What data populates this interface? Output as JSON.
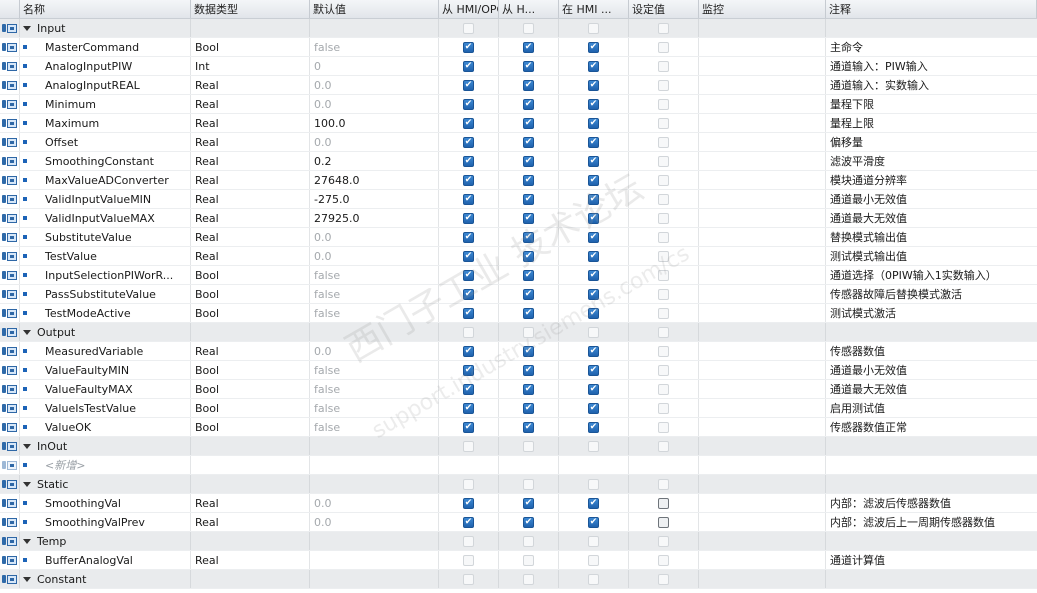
{
  "headers": {
    "name": "名称",
    "type": "数据类型",
    "default": "默认值",
    "hmi_opc": "从 HMI/OPC...",
    "hmi_h": "从 H...",
    "hmi_in": "在 HMI ...",
    "setpoint": "设定值",
    "monitor": "监控",
    "comment": "注释"
  },
  "rows": [
    {
      "kind": "section",
      "name": "Input",
      "icon": "interface-icon"
    },
    {
      "kind": "var",
      "name": "MasterCommand",
      "type": "Bool",
      "default": "false",
      "default_muted": true,
      "hmi": [
        true,
        true,
        true
      ],
      "set": "off",
      "comment": "主命令"
    },
    {
      "kind": "var",
      "name": "AnalogInputPIW",
      "type": "Int",
      "default": "0",
      "default_muted": true,
      "hmi": [
        true,
        true,
        true
      ],
      "set": "off",
      "comment": "通道输入：PIW输入"
    },
    {
      "kind": "var",
      "name": "AnalogInputREAL",
      "type": "Real",
      "default": "0.0",
      "default_muted": true,
      "hmi": [
        true,
        true,
        true
      ],
      "set": "off",
      "comment": "通道输入：实数输入"
    },
    {
      "kind": "var",
      "name": "Minimum",
      "type": "Real",
      "default": "0.0",
      "default_muted": true,
      "hmi": [
        true,
        true,
        true
      ],
      "set": "off",
      "comment": "量程下限"
    },
    {
      "kind": "var",
      "name": "Maximum",
      "type": "Real",
      "default": "100.0",
      "default_muted": false,
      "hmi": [
        true,
        true,
        true
      ],
      "set": "off",
      "comment": "量程上限"
    },
    {
      "kind": "var",
      "name": "Offset",
      "type": "Real",
      "default": "0.0",
      "default_muted": true,
      "hmi": [
        true,
        true,
        true
      ],
      "set": "off",
      "comment": "偏移量"
    },
    {
      "kind": "var",
      "name": "SmoothingConstant",
      "type": "Real",
      "default": "0.2",
      "default_muted": false,
      "hmi": [
        true,
        true,
        true
      ],
      "set": "off",
      "comment": "滤波平滑度"
    },
    {
      "kind": "var",
      "name": "MaxValueADConverter",
      "type": "Real",
      "default": "27648.0",
      "default_muted": false,
      "hmi": [
        true,
        true,
        true
      ],
      "set": "off",
      "comment": "模块通道分辨率"
    },
    {
      "kind": "var",
      "name": "ValidInputValueMIN",
      "type": "Real",
      "default": "-275.0",
      "default_muted": false,
      "hmi": [
        true,
        true,
        true
      ],
      "set": "off",
      "comment": "通道最小无效值"
    },
    {
      "kind": "var",
      "name": "ValidInputValueMAX",
      "type": "Real",
      "default": "27925.0",
      "default_muted": false,
      "hmi": [
        true,
        true,
        true
      ],
      "set": "off",
      "comment": "通道最大无效值"
    },
    {
      "kind": "var",
      "name": "SubstituteValue",
      "type": "Real",
      "default": "0.0",
      "default_muted": true,
      "hmi": [
        true,
        true,
        true
      ],
      "set": "off",
      "comment": "替换模式输出值"
    },
    {
      "kind": "var",
      "name": "TestValue",
      "type": "Real",
      "default": "0.0",
      "default_muted": true,
      "hmi": [
        true,
        true,
        true
      ],
      "set": "off",
      "comment": "测试模式输出值"
    },
    {
      "kind": "var",
      "name": "InputSelectionPIWorR...",
      "type": "Bool",
      "default": "false",
      "default_muted": true,
      "hmi": [
        true,
        true,
        true
      ],
      "set": "off",
      "comment": "通道选择（0PIW输入1实数输入）"
    },
    {
      "kind": "var",
      "name": "PassSubstituteValue",
      "type": "Bool",
      "default": "false",
      "default_muted": true,
      "hmi": [
        true,
        true,
        true
      ],
      "set": "off",
      "comment": "传感器故障后替换模式激活"
    },
    {
      "kind": "var",
      "name": "TestModeActive",
      "type": "Bool",
      "default": "false",
      "default_muted": true,
      "hmi": [
        true,
        true,
        true
      ],
      "set": "off",
      "comment": "测试模式激活"
    },
    {
      "kind": "section",
      "name": "Output",
      "icon": "interface-icon"
    },
    {
      "kind": "var",
      "name": "MeasuredVariable",
      "type": "Real",
      "default": "0.0",
      "default_muted": true,
      "hmi": [
        true,
        true,
        true
      ],
      "set": "off",
      "comment": "传感器数值"
    },
    {
      "kind": "var",
      "name": "ValueFaultyMIN",
      "type": "Bool",
      "default": "false",
      "default_muted": true,
      "hmi": [
        true,
        true,
        true
      ],
      "set": "off",
      "comment": "通道最小无效值"
    },
    {
      "kind": "var",
      "name": "ValueFaultyMAX",
      "type": "Bool",
      "default": "false",
      "default_muted": true,
      "hmi": [
        true,
        true,
        true
      ],
      "set": "off",
      "comment": "通道最大无效值"
    },
    {
      "kind": "var",
      "name": "ValueIsTestValue",
      "type": "Bool",
      "default": "false",
      "default_muted": true,
      "hmi": [
        true,
        true,
        true
      ],
      "set": "off",
      "comment": "启用测试值"
    },
    {
      "kind": "var",
      "name": "ValueOK",
      "type": "Bool",
      "default": "false",
      "default_muted": true,
      "hmi": [
        true,
        true,
        true
      ],
      "set": "off",
      "comment": "传感器数值正常"
    },
    {
      "kind": "section",
      "name": "InOut",
      "icon": "interface-icon"
    },
    {
      "kind": "add",
      "name": "<新增>",
      "icon": "interface-icon-muted"
    },
    {
      "kind": "section",
      "name": "Static",
      "icon": "interface-icon"
    },
    {
      "kind": "var",
      "name": "SmoothingVal",
      "type": "Real",
      "default": "0.0",
      "default_muted": true,
      "hmi": [
        true,
        true,
        true
      ],
      "set": "strong",
      "comment": "内部：滤波后传感器数值"
    },
    {
      "kind": "var",
      "name": "SmoothingValPrev",
      "type": "Real",
      "default": "0.0",
      "default_muted": true,
      "hmi": [
        true,
        true,
        true
      ],
      "set": "strong",
      "comment": "内部：滤波后上一周期传感器数值"
    },
    {
      "kind": "section",
      "name": "Temp",
      "icon": "interface-icon"
    },
    {
      "kind": "var",
      "name": "BufferAnalogVal",
      "type": "Real",
      "default": "",
      "default_muted": true,
      "hmi": [
        false,
        false,
        false
      ],
      "set": "off",
      "comment": "通道计算值"
    },
    {
      "kind": "section",
      "name": "Constant",
      "icon": "interface-icon"
    }
  ],
  "watermark": "西门子工业 技术论坛",
  "watermark_url": "support.industry.siemens.com/cs"
}
